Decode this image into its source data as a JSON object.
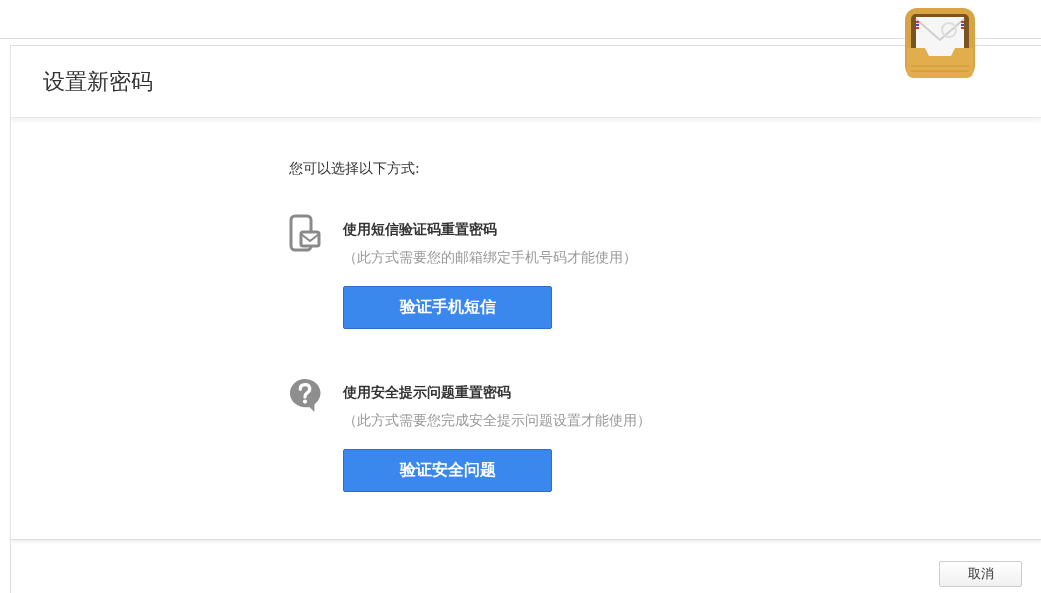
{
  "dialog": {
    "title": "设置新密码"
  },
  "intro": "您可以选择以下方式:",
  "options": [
    {
      "kind": "sms",
      "title": "使用短信验证码重置密码",
      "note": "（此方式需要您的邮箱绑定手机号码才能使用）",
      "button": "验证手机短信"
    },
    {
      "kind": "question",
      "title": "使用安全提示问题重置密码",
      "note": "（此方式需要您完成安全提示问题设置才能使用）",
      "button": "验证安全问题"
    }
  ],
  "footer": {
    "cancel": "取消"
  }
}
